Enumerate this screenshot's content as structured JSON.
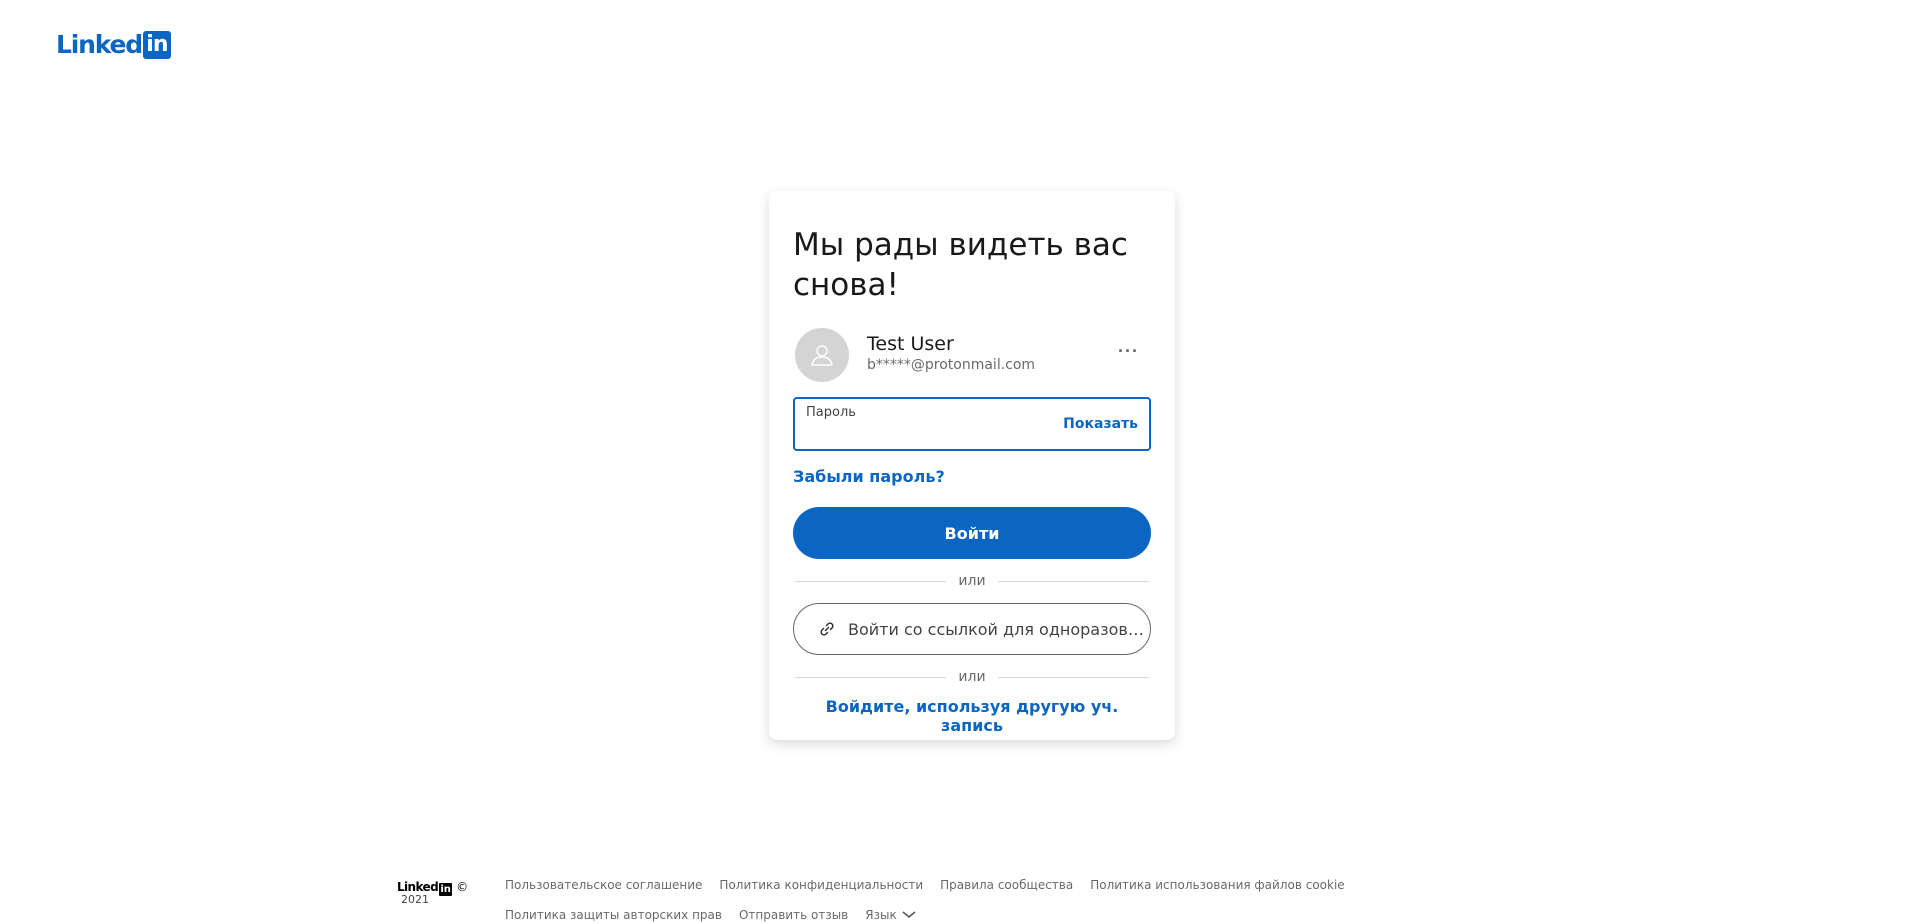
{
  "brand": {
    "word": "Linked",
    "box": "in",
    "color": "#0a66c2"
  },
  "card": {
    "title": "Мы рады видеть вас снова!",
    "profile": {
      "name": "Test User",
      "email": "b*****@protonmail.com",
      "avatar_icon": "user-silhouette-icon",
      "more_label": "···"
    },
    "password": {
      "label": "Пароль",
      "value": "",
      "show_label": "Показать"
    },
    "forgot_label": "Забыли пароль?",
    "signin_label": "Войти",
    "or_label": "или",
    "magic_link_label": "Войти со ссылкой для одноразового входа",
    "magic_link_icon": "link-icon",
    "other_account_label": "Войдите, используя другую уч. запись"
  },
  "footer": {
    "logo_word": "Linked",
    "logo_box": "in",
    "copyright": "©",
    "year": "2021",
    "links": [
      "Пользовательское соглашение",
      "Политика конфиденциальности",
      "Правила сообщества",
      "Политика использования файлов cookie",
      "Политика защиты авторских прав",
      "Отправить отзыв"
    ],
    "language_label": "Язык"
  }
}
